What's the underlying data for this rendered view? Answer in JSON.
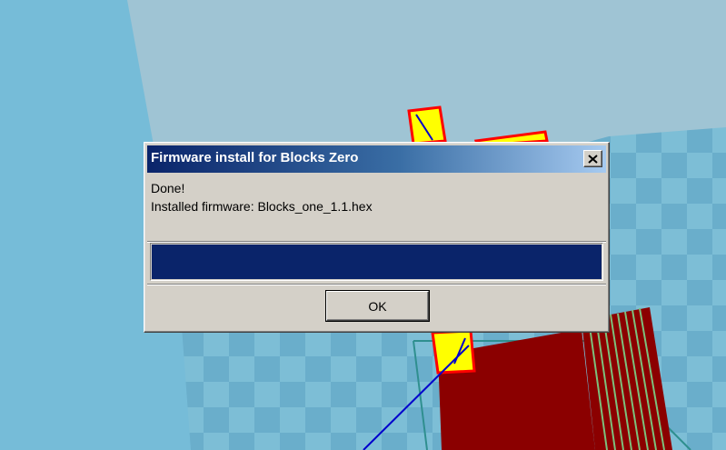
{
  "dialog": {
    "title": "Firmware install for Blocks Zero",
    "close_label": "×",
    "message_line1": "Done!",
    "message_line2": "Installed firmware: Blocks_one_1.1.hex",
    "progress": 1.0,
    "ok_label": "OK"
  },
  "colors": {
    "sky": "#9fc4d4",
    "floor_light": "#7dbed6",
    "floor_dark": "#6aaecb",
    "model_red": "#8b0000",
    "outline_red": "#ff0000",
    "highlight_yellow": "#ffff00",
    "path_blue": "#0000cc",
    "progress_fill": "#0a246a",
    "titlebar_start": "#0a246a",
    "titlebar_end": "#a6caf0"
  }
}
